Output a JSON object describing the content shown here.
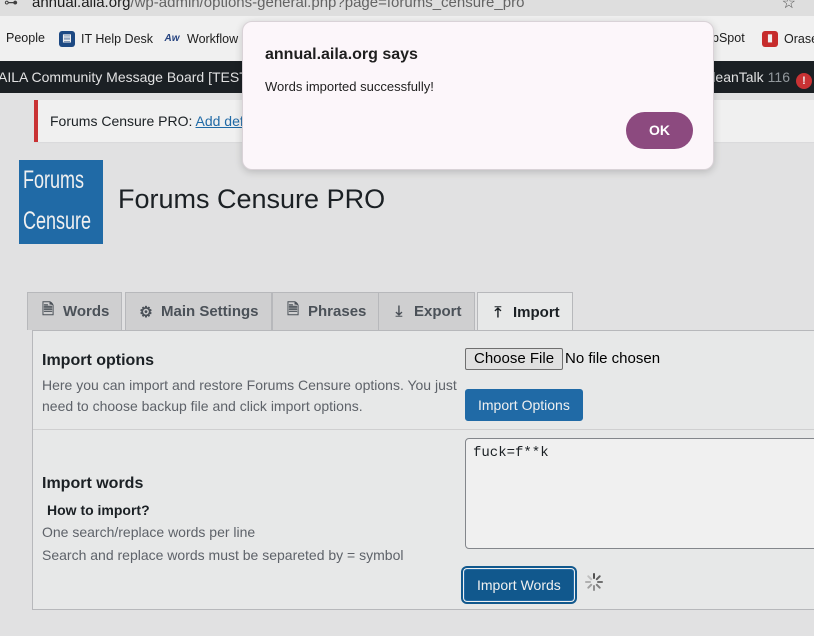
{
  "browser": {
    "url_host": "annual.aila.org",
    "url_path": "/wp-admin/options-general.php?page=forums_censure_pro"
  },
  "bookmarks": [
    {
      "label": "People",
      "icon": "people-icon",
      "color": ""
    },
    {
      "label": "IT Help Desk",
      "icon": "helpdesk-icon",
      "color": "#1f4e8c"
    },
    {
      "label": "Workflow",
      "icon": "workflow-icon",
      "color": "#2b4a8a"
    },
    {
      "label": "bSpot",
      "icon": "hubspot-icon",
      "color": ""
    },
    {
      "label": "Orase",
      "icon": "orase-icon",
      "color": "#d32f2f"
    }
  ],
  "adminbar": {
    "site_name": "AILA Community Message Board [TEST]",
    "cleantalk_label": "leanTalk",
    "cleantalk_count": "116",
    "alert_glyph": "!"
  },
  "notice": {
    "prefix": "Forums Censure PRO:",
    "link": "Add defau"
  },
  "header": {
    "logo_line1": "Forums",
    "logo_line2": "Censure",
    "title": "Forums Censure PRO"
  },
  "tabs": [
    {
      "label": "Words",
      "icon": "document-icon"
    },
    {
      "label": "Main Settings",
      "icon": "gear-icon"
    },
    {
      "label": "Phrases",
      "icon": "document-icon"
    },
    {
      "label": "Export",
      "icon": "download-icon"
    },
    {
      "label": "Import",
      "icon": "upload-icon"
    }
  ],
  "active_tab": "Import",
  "import_options": {
    "heading": "Import options",
    "desc_line1": "Here you can import and restore Forums Censure options. You just",
    "desc_line2": "need to choose backup file and click import options.",
    "choose_file_label": "Choose File",
    "no_file_text": "No file chosen",
    "button_label": "Import Options"
  },
  "import_words": {
    "heading": "Import words",
    "subheading": "How to import?",
    "desc_line1": "One search/replace words per line",
    "desc_line2": "Search and replace words must be separeted by = symbol",
    "textarea_value": "fuck=f**k",
    "button_label": "Import Words"
  },
  "dialog": {
    "title": "annual.aila.org says",
    "message": "Words imported successfully!",
    "ok_label": "OK"
  },
  "colors": {
    "wp_primary": "#2271b1",
    "adminbar_bg": "#1d2327",
    "notice_border": "#d63638",
    "dialog_ok": "#8c4a7f"
  }
}
